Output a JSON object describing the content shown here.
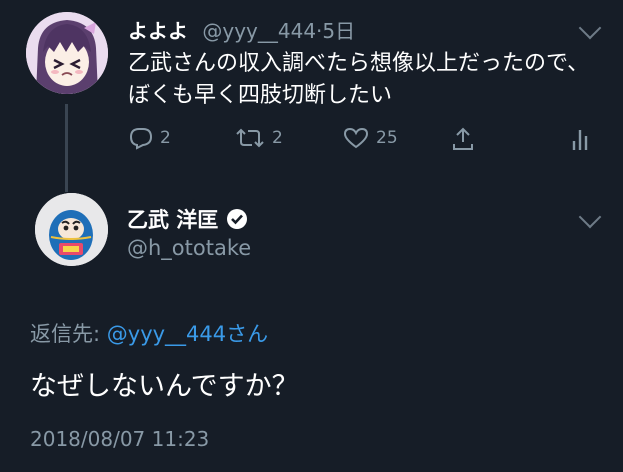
{
  "first_tweet": {
    "display_name": "よよよ",
    "handle": "@yyy__444",
    "separator": "·",
    "age": "5日",
    "text": "乙武さんの収入調べたら想像以上だったので、ぼくも早く四肢切断したい",
    "reply_count": "2",
    "retweet_count": "2",
    "like_count": "25"
  },
  "second_tweet": {
    "display_name": "乙武 洋匡",
    "handle": "@h_ototake",
    "reply_to_label": "返信先: ",
    "reply_to_mention": "@yyy__444",
    "reply_to_suffix": "さん",
    "text": "なぜしないんですか？",
    "timestamp": "2018/08/07 11:23"
  },
  "icons": {
    "reply": "reply-icon",
    "retweet": "retweet-icon",
    "like": "heart-icon",
    "share": "share-icon",
    "analytics": "analytics-icon",
    "caret": "chevron-down-icon",
    "verified": "verified-badge-icon"
  },
  "colors": {
    "background": "#161d27",
    "secondary_text": "#8899a6",
    "link": "#3a9ae8"
  }
}
